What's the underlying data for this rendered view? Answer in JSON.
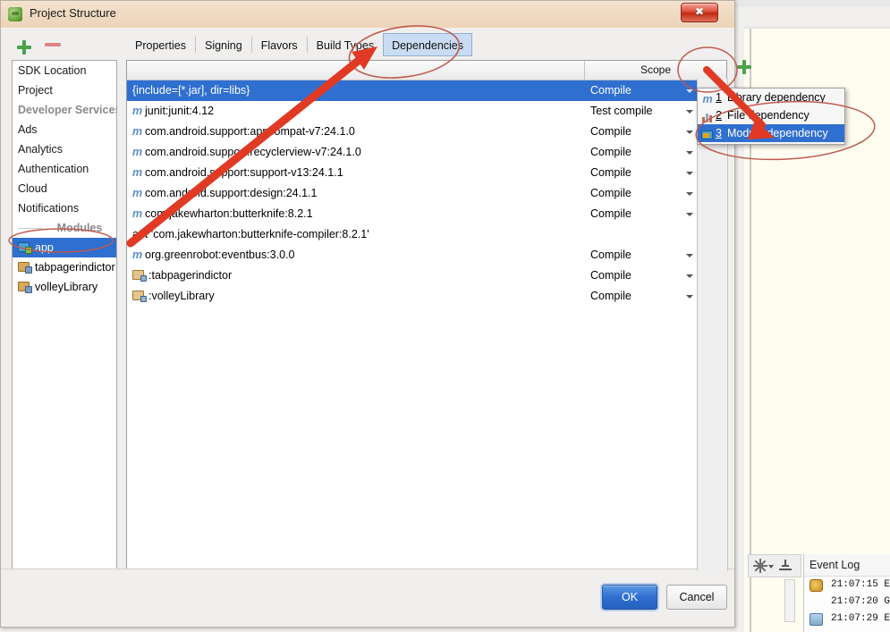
{
  "window": {
    "title": "Project Structure",
    "icon": "android-studio-icon",
    "close_label": "✖"
  },
  "toolbar": {
    "add_icon": "plus-icon",
    "remove_icon": "minus-icon"
  },
  "sidebar": {
    "items": [
      {
        "label": "SDK Location",
        "dim": false
      },
      {
        "label": "Project",
        "dim": false
      },
      {
        "label": "Developer Services",
        "dim": true
      },
      {
        "label": "Ads",
        "dim": false
      },
      {
        "label": "Analytics",
        "dim": false
      },
      {
        "label": "Authentication",
        "dim": false
      },
      {
        "label": "Cloud",
        "dim": false
      },
      {
        "label": "Notifications",
        "dim": false
      }
    ],
    "modules_label": "Modules",
    "modules": [
      {
        "label": "app",
        "selected": true,
        "icon": "android-app-module-icon"
      },
      {
        "label": "tabpagerindictor",
        "selected": false,
        "icon": "library-module-icon"
      },
      {
        "label": "volleyLibrary",
        "selected": false,
        "icon": "library-module-icon"
      }
    ]
  },
  "tabs": [
    {
      "label": "Properties",
      "active": false
    },
    {
      "label": "Signing",
      "active": false
    },
    {
      "label": "Flavors",
      "active": false
    },
    {
      "label": "Build Types",
      "active": false
    },
    {
      "label": "Dependencies",
      "active": true
    }
  ],
  "table": {
    "columns": [
      "",
      "Scope"
    ],
    "rows": [
      {
        "name": "{include=[*.jar], dir=libs}",
        "scope": "Compile",
        "icon": "none",
        "selected": true,
        "has_dropdown": true
      },
      {
        "name": "junit:junit:4.12",
        "scope": "Test compile",
        "icon": "maven-icon",
        "selected": false,
        "has_dropdown": true
      },
      {
        "name": "com.android.support:appcompat-v7:24.1.0",
        "scope": "Compile",
        "icon": "maven-icon",
        "selected": false,
        "has_dropdown": true
      },
      {
        "name": "com.android.support:recyclerview-v7:24.1.0",
        "scope": "Compile",
        "icon": "maven-icon",
        "selected": false,
        "has_dropdown": true
      },
      {
        "name": "com.android.support:support-v13:24.1.1",
        "scope": "Compile",
        "icon": "maven-icon",
        "selected": false,
        "has_dropdown": true
      },
      {
        "name": "com.android.support:design:24.1.1",
        "scope": "Compile",
        "icon": "maven-icon",
        "selected": false,
        "has_dropdown": true
      },
      {
        "name": "com.jakewharton:butterknife:8.2.1",
        "scope": "Compile",
        "icon": "maven-icon",
        "selected": false,
        "has_dropdown": true
      },
      {
        "name": "apt 'com.jakewharton:butterknife-compiler:8.2.1'",
        "scope": "",
        "icon": "none",
        "selected": false,
        "has_dropdown": false
      },
      {
        "name": "org.greenrobot:eventbus:3.0.0",
        "scope": "Compile",
        "icon": "maven-icon",
        "selected": false,
        "has_dropdown": true
      },
      {
        "name": ":tabpagerindictor",
        "scope": "Compile",
        "icon": "module-icon",
        "selected": false,
        "has_dropdown": true
      },
      {
        "name": ":volleyLibrary",
        "scope": "Compile",
        "icon": "module-icon",
        "selected": false,
        "has_dropdown": true
      }
    ]
  },
  "add_dependency_menu": {
    "trigger_icon": "plus-icon",
    "items": [
      {
        "number": "1",
        "label": "Library dependency",
        "icon": "maven-icon",
        "selected": false
      },
      {
        "number": "2",
        "label": "File dependency",
        "icon": "file-bars-icon",
        "selected": false
      },
      {
        "number": "3",
        "label": "Module dependency",
        "icon": "module-icon",
        "selected": true
      }
    ]
  },
  "footer": {
    "ok_label": "OK",
    "cancel_label": "Cancel"
  },
  "ide": {
    "toolwindow": {
      "gear_icon": "gear-icon",
      "hide_icon": "hide-icon"
    },
    "event_log": {
      "title": "Event Log",
      "entries": [
        {
          "time": "21:07:15",
          "text": "Ex",
          "icon": "wrench-icon"
        },
        {
          "time": "21:07:20",
          "text": "Gr",
          "icon": "none"
        },
        {
          "time": "21:07:29",
          "text": "Ex",
          "icon": "chat-icon"
        }
      ]
    }
  },
  "annotations": {
    "color": "#e03a24",
    "ellipse_color": "#c66",
    "marks": [
      {
        "name": "ellipse-around-dependencies-tab"
      },
      {
        "name": "arrow-to-dependencies-tab"
      },
      {
        "name": "ellipse-around-plus-button"
      },
      {
        "name": "ellipse-around-module-dependency"
      },
      {
        "name": "arrow-to-module-dependency"
      },
      {
        "name": "ellipse-around-app-module"
      }
    ]
  }
}
